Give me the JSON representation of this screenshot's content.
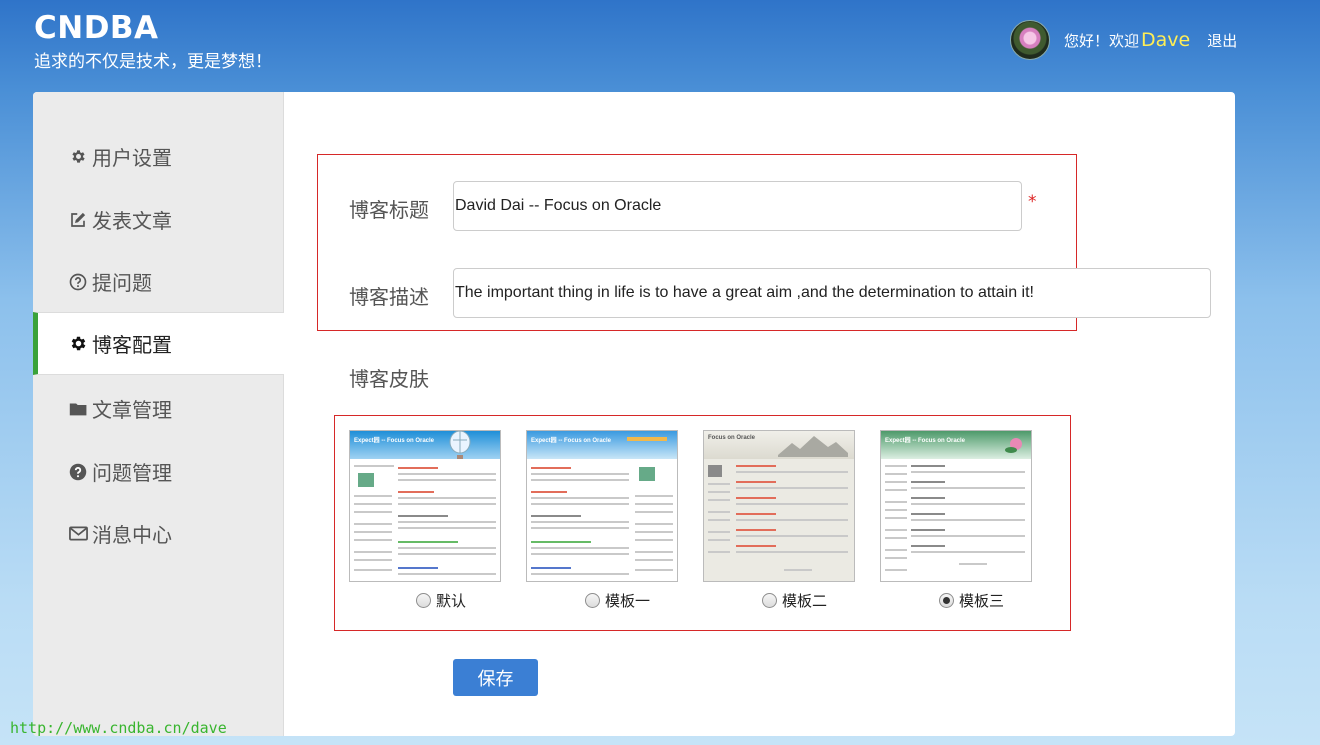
{
  "header": {
    "title": "CNDBA",
    "subtitle": "追求的不仅是技术，更是梦想！",
    "greeting": "您好！欢迎",
    "username": "Dave",
    "logout": "退出"
  },
  "sidebar": {
    "items": [
      {
        "label": "用户设置",
        "icon": "gear-icon"
      },
      {
        "label": "发表文章",
        "icon": "edit-icon"
      },
      {
        "label": "提问题",
        "icon": "question-circle-icon"
      },
      {
        "label": "博客配置",
        "icon": "gear-icon",
        "active": true
      },
      {
        "label": "文章管理",
        "icon": "folder-icon"
      },
      {
        "label": "问题管理",
        "icon": "question-icon"
      },
      {
        "label": "消息中心",
        "icon": "envelope-icon"
      }
    ]
  },
  "form": {
    "title_label": "博客标题",
    "title_value": "David Dai -- Focus on Oracle",
    "required_mark": "*",
    "desc_label": "博客描述",
    "desc_value": "The important thing in life is to have a great aim ,and the determination to attain it!",
    "skin_label": "博客皮肤",
    "skins": [
      {
        "label": "默认",
        "checked": false,
        "thumb_title": "Expect园 -- Focus on Oracle"
      },
      {
        "label": "模板一",
        "checked": false,
        "thumb_title": "Expect园 -- Focus on Oracle"
      },
      {
        "label": "模板二",
        "checked": false,
        "thumb_title": "Focus on Oracle"
      },
      {
        "label": "模板三",
        "checked": true,
        "thumb_title": "Expect园 -- Focus on Oracle"
      }
    ],
    "save_label": "保存"
  },
  "footer": {
    "url": "http://www.cndba.cn/dave"
  },
  "colors": {
    "header_bg": "#2f74c9",
    "username": "#ffee55",
    "active_accent": "#3aa23a",
    "highlight_box": "#d62828",
    "save_button": "#3b7fd4",
    "footer_url": "#39b52f"
  }
}
